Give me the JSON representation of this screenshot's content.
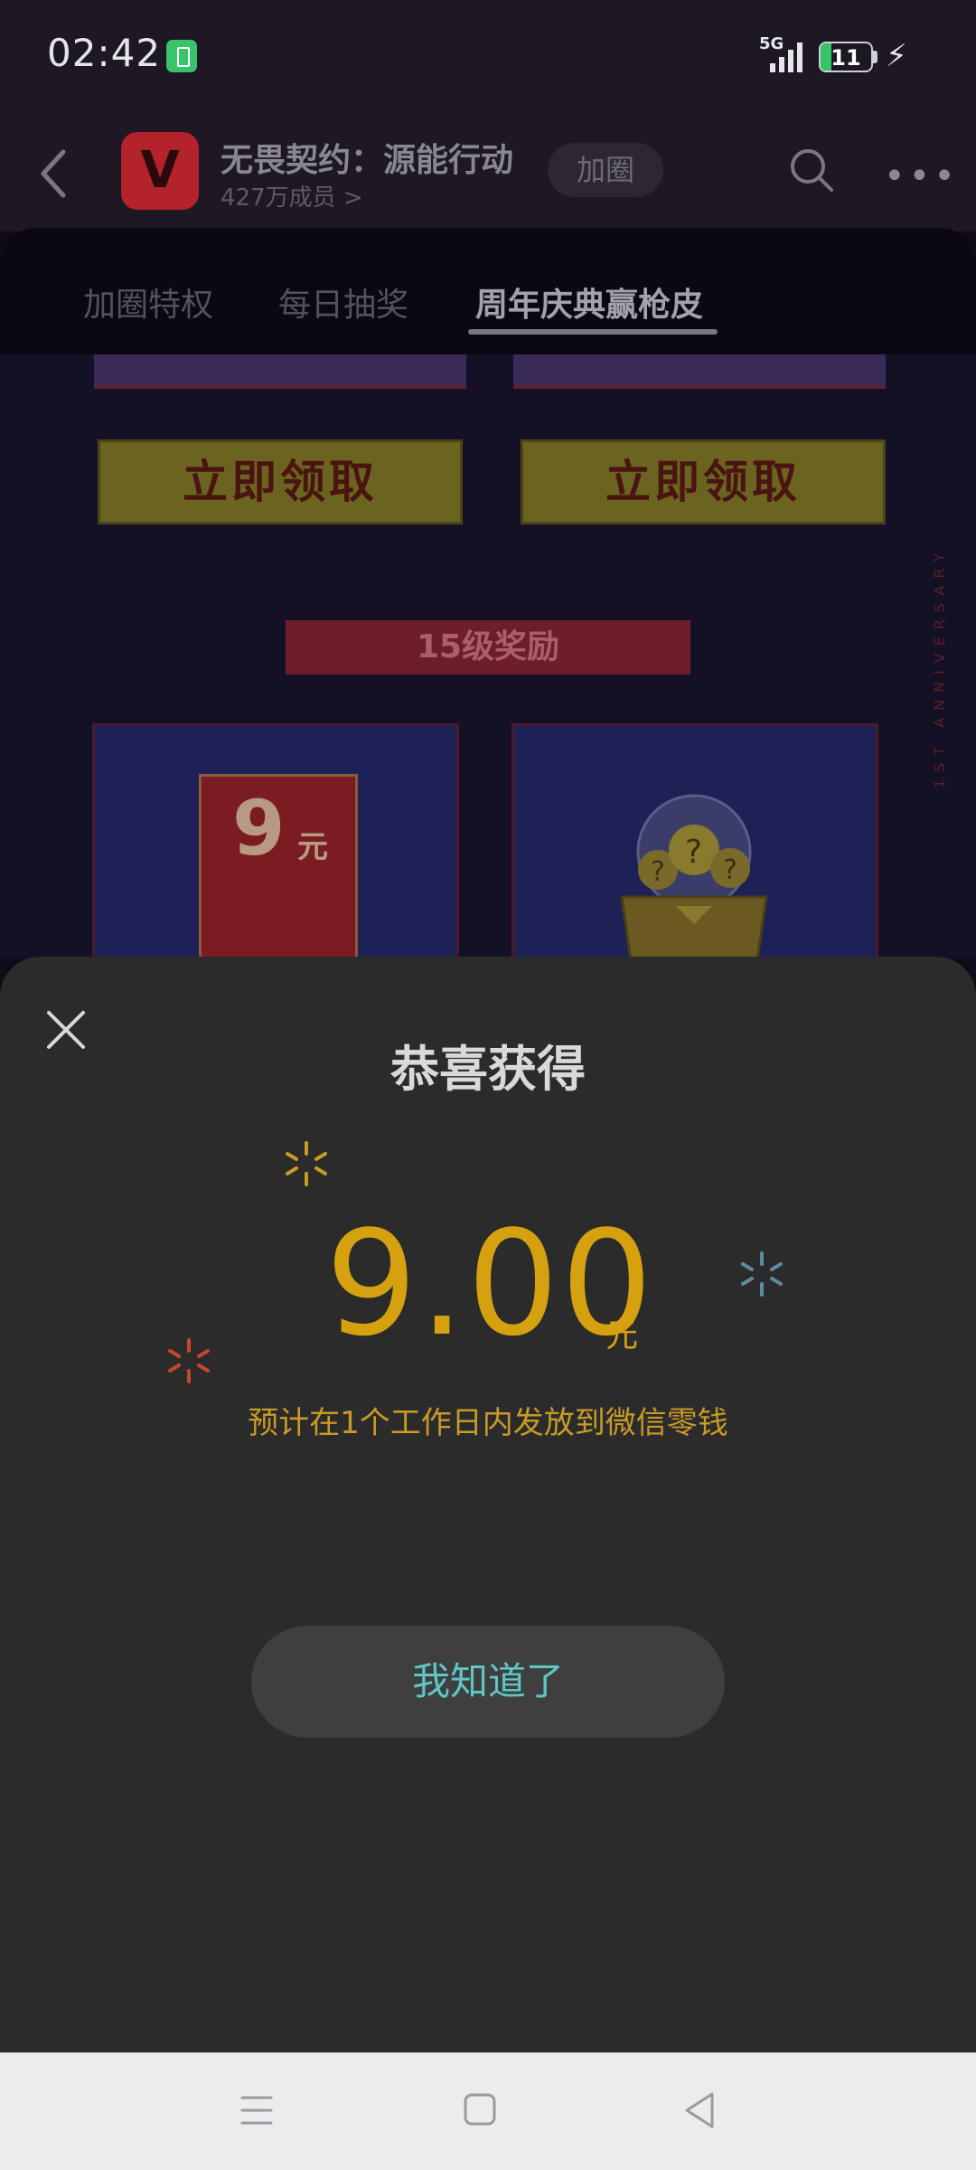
{
  "status_bar": {
    "time": "02:42",
    "network": "5G",
    "battery_level": "11",
    "icons": [
      "battery-saver-icon",
      "signal-icon",
      "battery-icon",
      "charging-icon"
    ]
  },
  "header": {
    "title": "无畏契约：源能行动",
    "members": "427万成员 >",
    "join_label": "加圈",
    "icons": [
      "back-arrow-icon",
      "search-icon",
      "more-icon"
    ]
  },
  "tabs": [
    {
      "label": "加圈特权",
      "active": false
    },
    {
      "label": "每日抽奖",
      "active": false
    },
    {
      "label": "周年庆典赢枪皮",
      "active": true
    }
  ],
  "background": {
    "claim_buttons": [
      "立即领取",
      "立即领取"
    ],
    "level_banner": "15级奖励",
    "red_packet_amount": "9",
    "red_packet_unit": "元",
    "vertical_text": "1ST ANNIVERSARY"
  },
  "modal": {
    "title": "恭喜获得",
    "amount": "9.00",
    "unit": "元",
    "note": "预计在1个工作日内发放到微信零钱",
    "button_label": "我知道了"
  },
  "colors": {
    "amount": "#d6a10f",
    "button_text": "#5ec7c4",
    "sheet_bg": "#2b2b2b"
  },
  "nav_bar": {
    "icons": [
      "menu-icon",
      "home-icon",
      "back-icon"
    ]
  }
}
